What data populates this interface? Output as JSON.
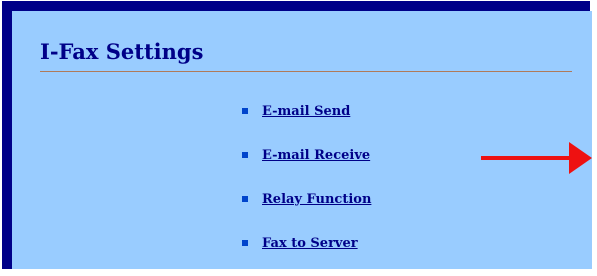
{
  "page": {
    "title": "I-Fax Settings"
  },
  "menu": {
    "items": [
      {
        "label": "E-mail Send"
      },
      {
        "label": "E-mail Receive"
      },
      {
        "label": "Relay Function"
      },
      {
        "label": "Fax to Server"
      }
    ]
  },
  "colors": {
    "frame": "#000088",
    "panel": "#99ccff",
    "title": "#000088",
    "link": "#000088",
    "bullet": "#0044cc",
    "divider": "#b07a5a",
    "arrow": "#ee1111"
  },
  "icons": {
    "bullet": "square-bullet-icon",
    "arrow": "red-arrow-icon"
  }
}
